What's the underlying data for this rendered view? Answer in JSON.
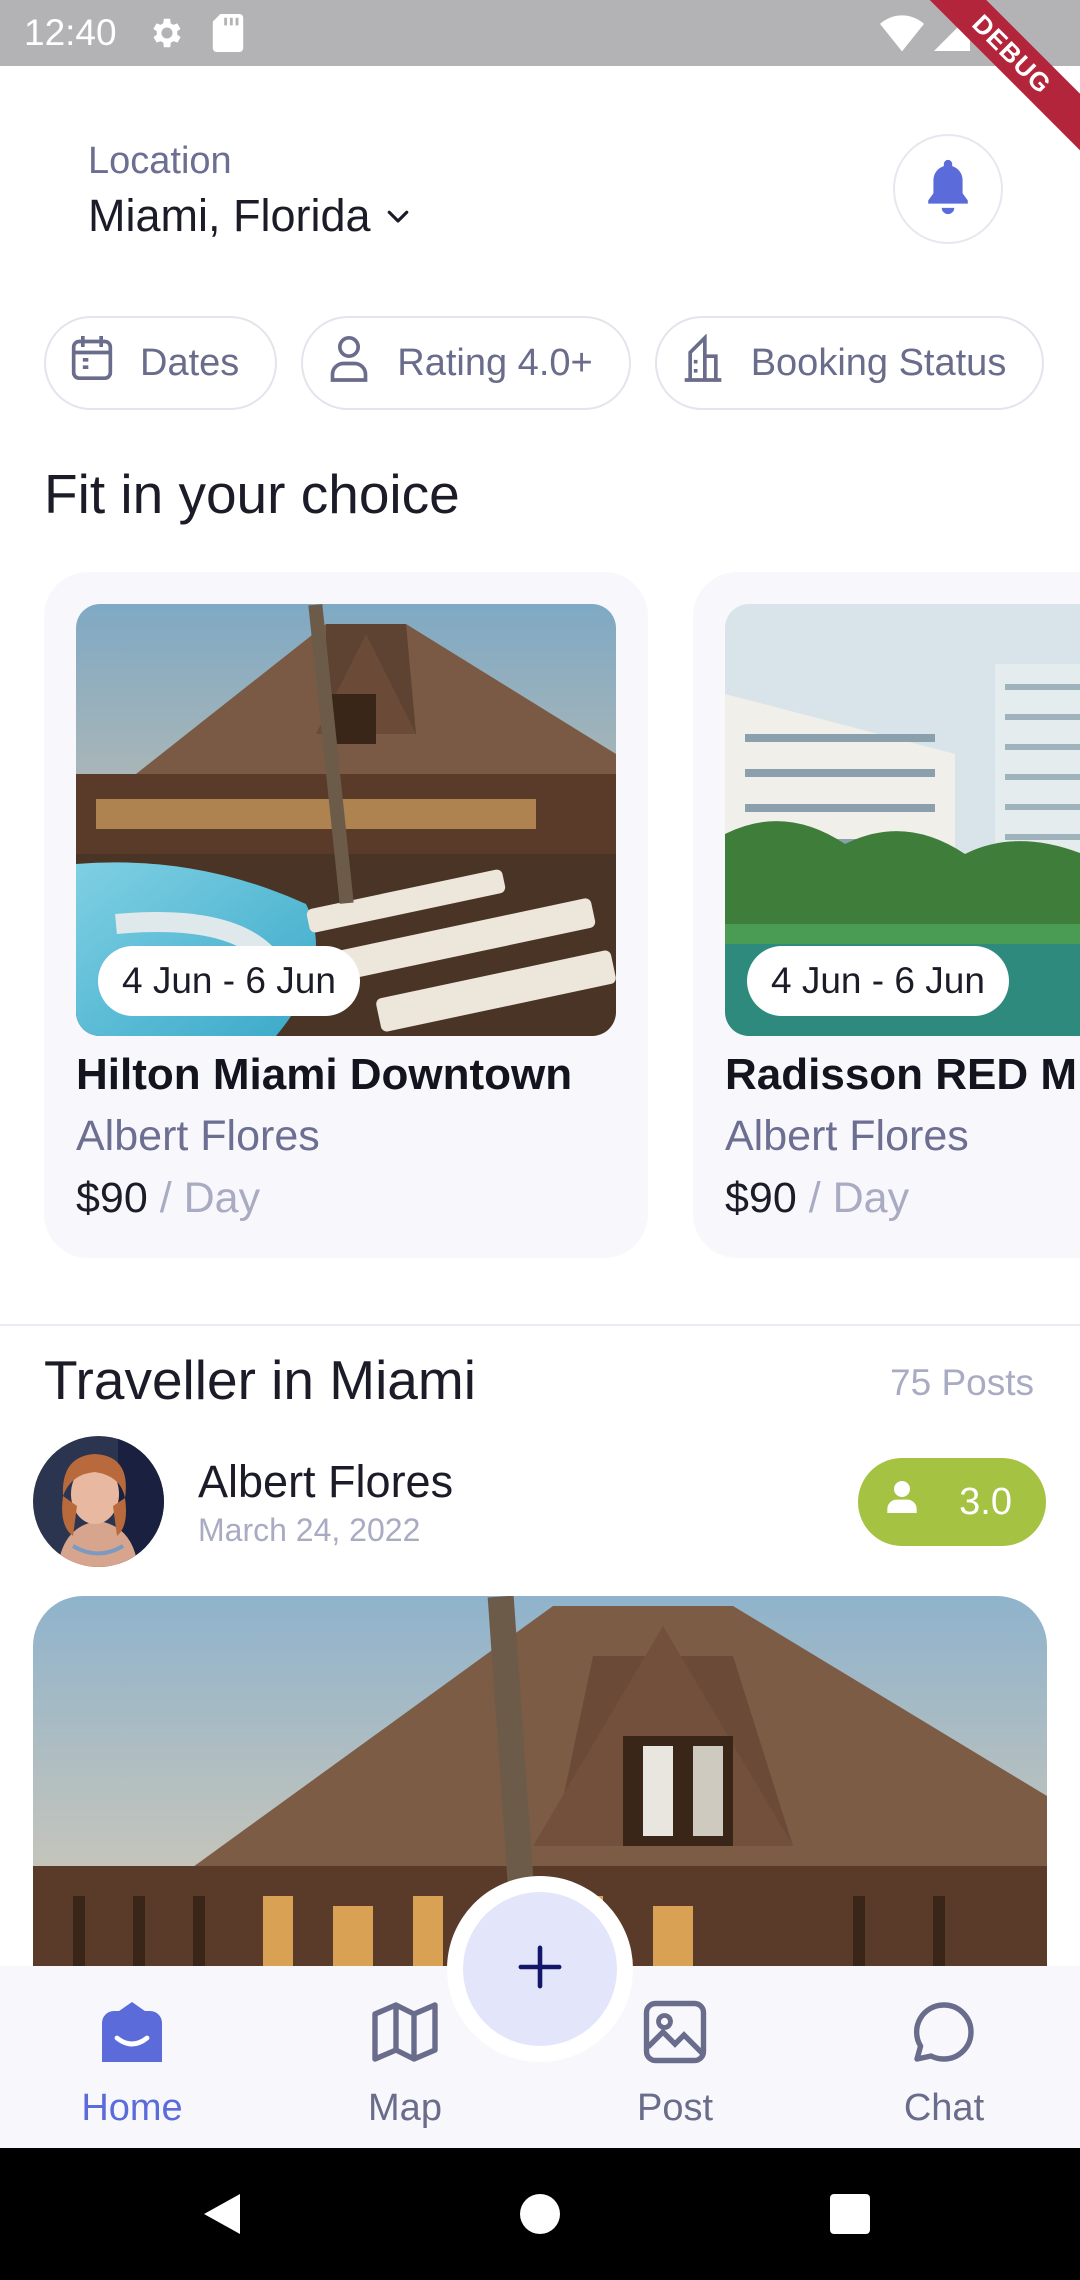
{
  "status_bar": {
    "time": "12:40",
    "debug_label": "DEBUG"
  },
  "header": {
    "location_label": "Location",
    "location_value": "Miami, Florida"
  },
  "filters": [
    {
      "label": "Dates",
      "icon": "calendar-icon"
    },
    {
      "label": "Rating 4.0+",
      "icon": "person-icon"
    },
    {
      "label": "Booking Status",
      "icon": "building-icon"
    }
  ],
  "choice_section": {
    "title": "Fit in your choice",
    "cards": [
      {
        "dates": "4 Jun - 6 Jun",
        "name": "Hilton Miami Downtown",
        "host": "Albert Flores",
        "price": "$90",
        "per": "/ Day"
      },
      {
        "dates": "4 Jun - 6 Jun",
        "name": "Radisson RED Miami",
        "host": "Albert Flores",
        "price": "$90",
        "per": "/ Day"
      }
    ]
  },
  "traveller_section": {
    "title": "Traveller in Miami",
    "posts_count": "75 Posts",
    "post": {
      "author": "Albert Flores",
      "date": "March 24, 2022",
      "rating": "3.0"
    }
  },
  "bottom_nav": {
    "items": [
      {
        "label": "Home",
        "icon": "home-icon",
        "active": true
      },
      {
        "label": "Map",
        "icon": "map-icon"
      },
      {
        "label": "Post",
        "icon": "image-icon"
      },
      {
        "label": "Chat",
        "icon": "chat-icon"
      }
    ],
    "fab_icon": "plus-icon"
  },
  "colors": {
    "accent": "#5b6bd9",
    "rating_green": "#a6c242",
    "muted": "#6c6e92"
  }
}
